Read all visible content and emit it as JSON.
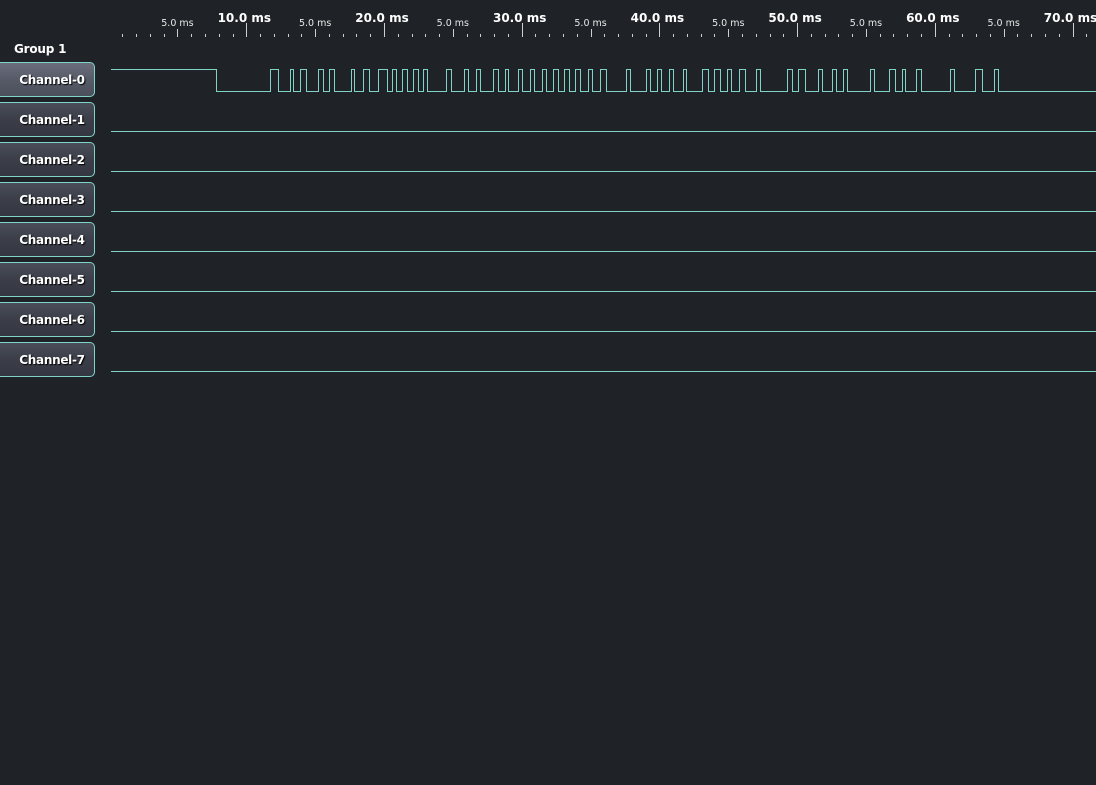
{
  "ruler": {
    "major_labels": [
      "10.0 ms",
      "20.0 ms",
      "30.0 ms",
      "40.0 ms",
      "50.0 ms",
      "60.0 ms",
      "70.0 ms"
    ],
    "minor_labels": [
      "5.0 ms",
      "5.0 ms",
      "5.0 ms",
      "5.0 ms",
      "5.0 ms",
      "5.0 ms",
      "5.0 ms"
    ]
  },
  "group": {
    "label": "Group 1"
  },
  "channels": [
    {
      "label": "Channel-0",
      "selected": true
    },
    {
      "label": "Channel-1",
      "selected": false
    },
    {
      "label": "Channel-2",
      "selected": false
    },
    {
      "label": "Channel-3",
      "selected": false
    },
    {
      "label": "Channel-4",
      "selected": false
    },
    {
      "label": "Channel-5",
      "selected": false
    },
    {
      "label": "Channel-6",
      "selected": false
    },
    {
      "label": "Channel-7",
      "selected": false
    }
  ],
  "colors": {
    "background": "#1f2226",
    "trace": "#7fd4c7",
    "ruler_text": "#ffffff"
  },
  "signal": {
    "channel": "Channel-0",
    "unit": "ms",
    "initial_level": "high",
    "transitions_ms": [
      7.8,
      11.7,
      12.3,
      13.2,
      13.4,
      13.9,
      14.3,
      15.2,
      15.6,
      16.0,
      16.4,
      17.6,
      17.8,
      18.5,
      18.9,
      19.6,
      20.2,
      20.6,
      20.9,
      21.3,
      21.7,
      22.1,
      22.5,
      22.8,
      23.1,
      24.5,
      24.9,
      25.8,
      26.1,
      26.7,
      27.0,
      27.9,
      28.3,
      28.8,
      29.0,
      29.7,
      30.0,
      30.6,
      30.9,
      31.5,
      31.8,
      32.3,
      32.6,
      33.1,
      33.4,
      33.9,
      34.2,
      34.8,
      35.1,
      35.7,
      36.1,
      37.6,
      37.9,
      39.0,
      39.3,
      39.8,
      40.1,
      40.7,
      41.0,
      41.7,
      41.9,
      43.1,
      43.5,
      44.0,
      44.4,
      44.9,
      45.2,
      45.8,
      46.2,
      47.0,
      47.3,
      49.3,
      49.6,
      50.1,
      50.6,
      51.5,
      51.8,
      52.5,
      52.8,
      53.3,
      53.6,
      55.3,
      55.6,
      56.7,
      57.1,
      57.6,
      57.8,
      58.6,
      59.0,
      61.1,
      61.4,
      62.9,
      63.4,
      64.3,
      64.6
    ]
  }
}
